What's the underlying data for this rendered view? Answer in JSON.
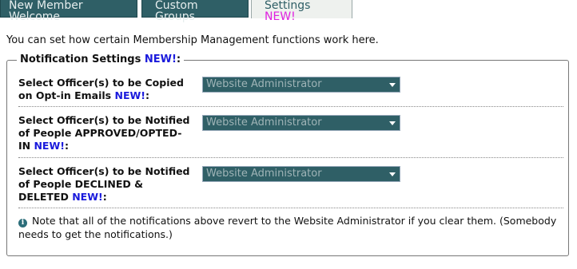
{
  "tabs": [
    {
      "label": "New Member Welcome",
      "badge": ""
    },
    {
      "label": "Custom Groups",
      "badge": ""
    },
    {
      "label": "Settings ",
      "badge": "NEW!"
    }
  ],
  "intro": "You can set how certain Membership Management functions work here.",
  "fieldset": {
    "legend": "Notification Settings ",
    "legend_badge": "NEW!",
    "legend_suffix": ":",
    "rows": [
      {
        "label": "Select Officer(s) to be Copied on Opt-in Emails ",
        "badge": "NEW!",
        "suffix": ":",
        "value": "Website Administrator"
      },
      {
        "label": "Select Officer(s) to be Notified of People APPROVED/OPTED-IN ",
        "badge": "NEW!",
        "suffix": ":",
        "value": "Website Administrator"
      },
      {
        "label": "Select Officer(s) to be Notified of People DECLINED & DELETED ",
        "badge": "NEW!",
        "suffix": ":",
        "value": "Website Administrator"
      }
    ],
    "note": "Note that all of the notifications above revert to the Website Administrator if you clear them. (Somebody needs to get the notifications.)"
  },
  "colors": {
    "tab_bg": "#2f5f66",
    "active_tab_bg": "#eef1ee",
    "new_badge": "#1a1adc",
    "tab_new_badge": "#e020e0"
  }
}
